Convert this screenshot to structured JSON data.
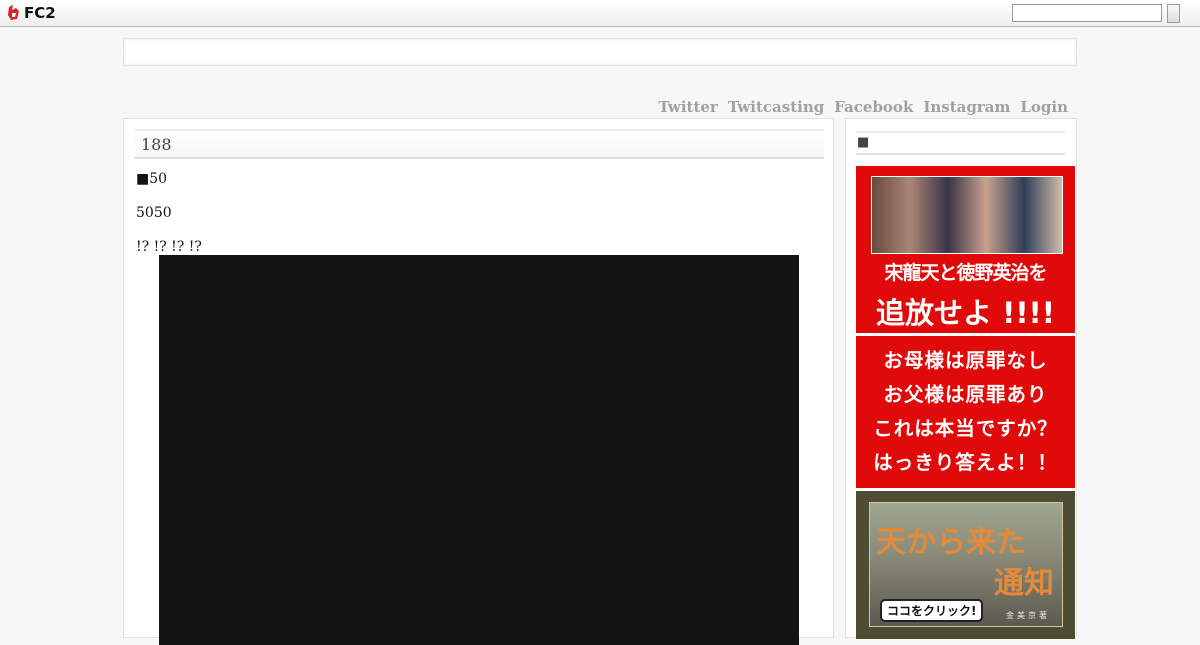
{
  "topbar": {
    "logo_text": "FC2",
    "search_value": "",
    "search_button_label": ""
  },
  "nav": {
    "items": [
      "Twitter",
      "Twitcasting",
      "Facebook",
      "Instagram",
      "Login"
    ]
  },
  "entry": {
    "title": "188",
    "paragraphs": [
      "■50",
      "5050",
      "!? !? !? !?"
    ]
  },
  "sidebar": {
    "title": "■",
    "banner1": {
      "line1": "宋龍天と徳野英治を",
      "line2": "追放せよ !!!!"
    },
    "banner2": {
      "lines": [
        "お母様は原罪なし",
        "お父様は原罪あり",
        "これは本当ですか？",
        "はっきり答えよ！！"
      ]
    },
    "banner3": {
      "title1": "天から来た",
      "title2": "通知",
      "author": "金美京著",
      "button": "ココをクリック!"
    }
  },
  "colors": {
    "banner_red": "#e10a0a",
    "nav_gray": "#a0a0a0",
    "video_black": "#141414"
  },
  "icons": {
    "fc2_logo": "fc2-fox-logo-icon"
  }
}
